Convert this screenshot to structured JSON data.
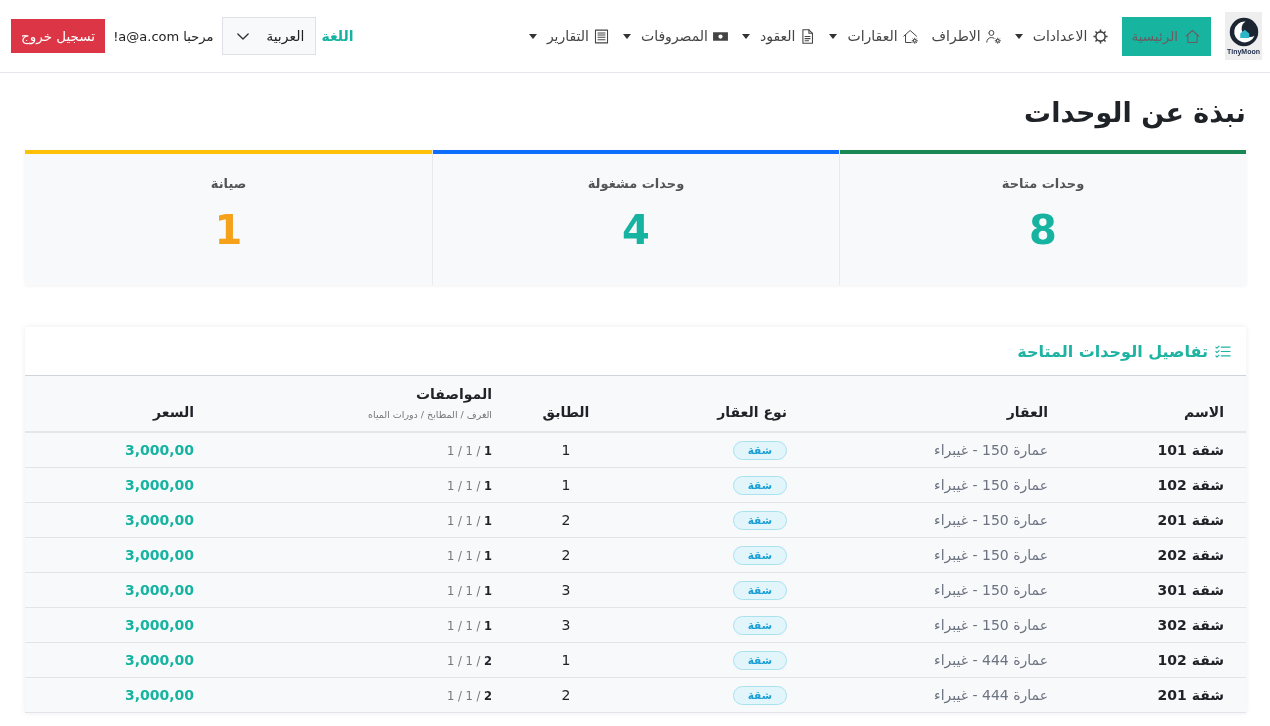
{
  "header": {
    "brand": "TinyMoon",
    "nav": [
      {
        "label": "الرئيسية",
        "selected": true,
        "dropdown": false
      },
      {
        "label": "الاعدادات",
        "selected": false,
        "dropdown": true
      },
      {
        "label": "الاطراف",
        "selected": false,
        "dropdown": false
      },
      {
        "label": "العقارات",
        "selected": false,
        "dropdown": true
      },
      {
        "label": "العقود",
        "selected": false,
        "dropdown": true
      },
      {
        "label": "المصروفات",
        "selected": false,
        "dropdown": true
      },
      {
        "label": "التقارير",
        "selected": false,
        "dropdown": true
      }
    ],
    "language_label": "اللغة",
    "language_select": {
      "value": "العربية"
    },
    "greeting": "مرحبا a@a.com!",
    "logout_button": "تسجيل خروج"
  },
  "page_title": "نبذة عن الوحدات",
  "stats": [
    {
      "label": "وحدات متاحة",
      "color": "#198754",
      "value": {
        "text": "8",
        "color": "#17b3a1"
      }
    },
    {
      "label": "وحدات مشغولة",
      "color": "#0d6efd",
      "value": {
        "text": "4",
        "color": "#17b3a1"
      }
    },
    {
      "label": "صيانة",
      "color": "#ffc107",
      "value": {
        "text": "1",
        "color": "#f5a11a"
      }
    }
  ],
  "units_table": {
    "title": "تفاصيل الوحدات المتاحة",
    "columns": [
      {
        "label": "الاسم"
      },
      {
        "label": "العقار"
      },
      {
        "label": "نوع العقار"
      },
      {
        "label": "الطابق"
      },
      {
        "label": "المواصفات",
        "sublabel": "الغرف / المطابخ / دورات المياه"
      },
      {
        "label": "السعر"
      }
    ],
    "rows": [
      {
        "name": "شقة 101",
        "property": "عمارة 150 - غيبراء",
        "type": "شقة",
        "floor": "1",
        "specs": "**1** / 1 / 1",
        "price": "3,000,00"
      },
      {
        "name": "شقة 102",
        "property": "عمارة 150 - غيبراء",
        "type": "شقة",
        "floor": "1",
        "specs": "**1** / 1 / 1",
        "price": "3,000,00"
      },
      {
        "name": "شقة 201",
        "property": "عمارة 150 - غيبراء",
        "type": "شقة",
        "floor": "2",
        "specs": "**1** / 1 / 1",
        "price": "3,000,00"
      },
      {
        "name": "شقة 202",
        "property": "عمارة 150 - غيبراء",
        "type": "شقة",
        "floor": "2",
        "specs": "**1** / 1 / 1",
        "price": "3,000,00"
      },
      {
        "name": "شقة 301",
        "property": "عمارة 150 - غيبراء",
        "type": "شقة",
        "floor": "3",
        "specs": "**1** / 1 / 1",
        "price": "3,000,00"
      },
      {
        "name": "شقة 302",
        "property": "عمارة 150 - غيبراء",
        "type": "شقة",
        "floor": "3",
        "specs": "**1** / 1 / 1",
        "price": "3,000,00"
      },
      {
        "name": "شقة 102",
        "property": "عمارة 444 - غيبراء",
        "type": "شقة",
        "floor": "1",
        "specs": "**2** / 1 / 1",
        "price": "3,000,00"
      },
      {
        "name": "شقة 201",
        "property": "عمارة 444 - غيبراء",
        "type": "شقة",
        "floor": "2",
        "specs": "**2** / 1 / 1",
        "price": "3,000,00"
      }
    ]
  }
}
